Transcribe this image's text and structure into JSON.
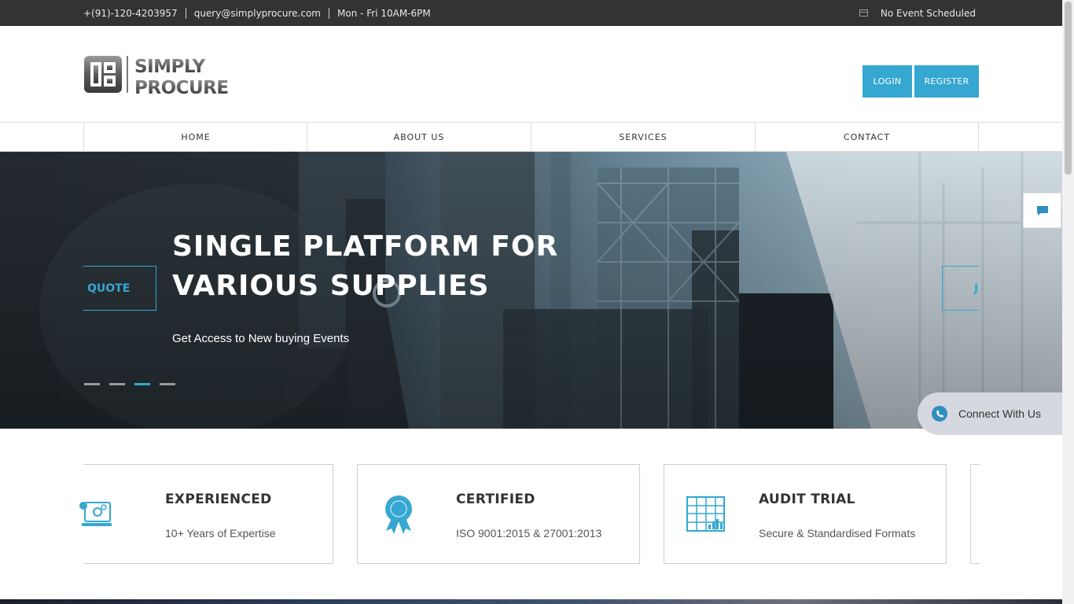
{
  "topbar": {
    "phone": "+(91)-120-4203957",
    "email": "query@simplyprocure.com",
    "hours": "Mon - Fri 10AM-6PM",
    "event_status": "No Event Scheduled",
    "event_icon": "calendar-icon"
  },
  "header": {
    "logo_line1": "SIMPLY",
    "logo_line2": "PROCURE",
    "login_label": "LOGIN",
    "register_label": "REGISTER"
  },
  "nav": {
    "items": [
      {
        "label": "HOME"
      },
      {
        "label": "ABOUT US"
      },
      {
        "label": "SERVICES"
      },
      {
        "label": "CONTACT"
      }
    ]
  },
  "hero": {
    "title": "SINGLE PLATFORM FOR VARIOUS SUPPLIES",
    "subtitle": "Get Access to New buying Events",
    "prev_label": "QUOTE",
    "next_label": "J",
    "slides": 4,
    "active_slide": 3
  },
  "widgets": {
    "chat_icon": "chat-bubble-icon",
    "connect_label": "Connect With Us",
    "connect_icon": "whatsapp-icon"
  },
  "features": [
    {
      "title": "EXPERIENCED",
      "desc": "10+ Years of Expertise",
      "icon": "monitor-gear-icon"
    },
    {
      "title": "CERTIFIED",
      "desc": "ISO 9001:2015 & 27001:2013",
      "icon": "award-ribbon-icon"
    },
    {
      "title": "AUDIT TRIAL",
      "desc": "Secure & Standardised Formats",
      "icon": "spreadsheet-chart-icon"
    }
  ],
  "colors": {
    "accent": "#35a7d1",
    "topbar_bg": "#333333",
    "text_dark": "#333333"
  }
}
